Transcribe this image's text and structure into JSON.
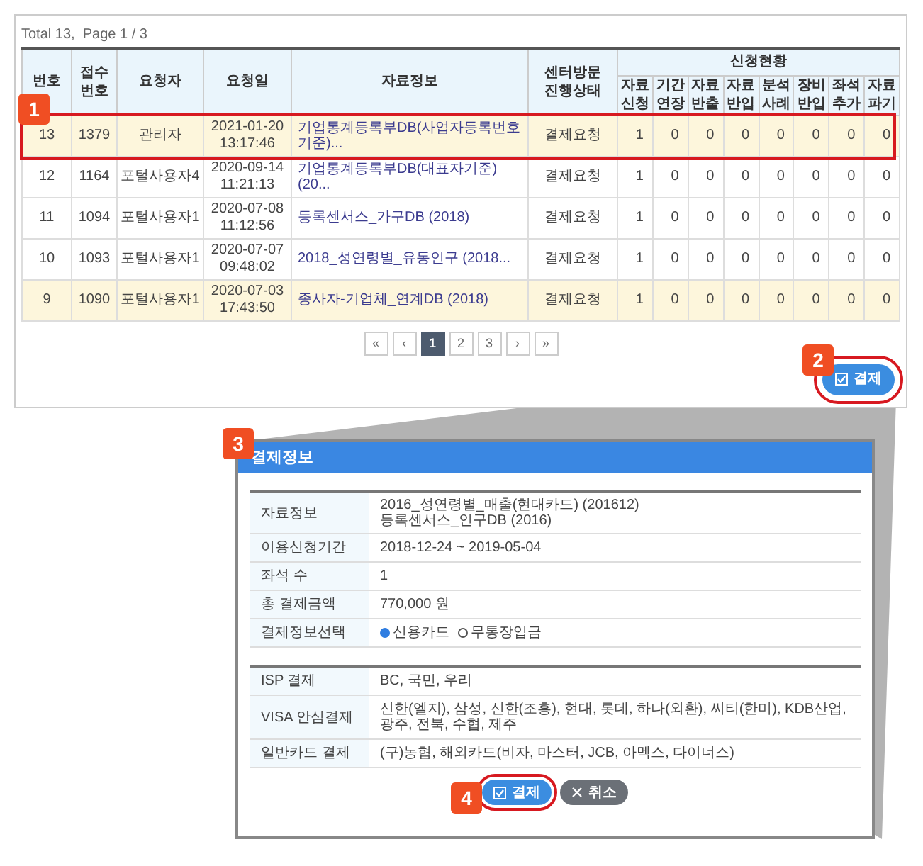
{
  "summary": "Total 13,  Page 1 / 3",
  "table": {
    "columns": [
      "번호",
      "접수\n번호",
      "요청자",
      "요청일",
      "자료정보",
      "센터방문\n진행상태"
    ],
    "group_header": "신청현황",
    "subcolumns": [
      "자료\n신청",
      "기간\n연장",
      "자료\n반출",
      "자료\n반입",
      "분석\n사례",
      "장비\n반입",
      "좌석\n추가",
      "자료\n파기"
    ],
    "rows": [
      {
        "no": "13",
        "receipt": "1379",
        "requester": "관리자",
        "date": "2021-01-20\n13:17:46",
        "data_info": "기업통계등록부DB(사업자등록번호기준)...",
        "status": "결제요청",
        "counts": [
          "1",
          "0",
          "0",
          "0",
          "0",
          "0",
          "0",
          "0"
        ],
        "highlighted": true
      },
      {
        "no": "12",
        "receipt": "1164",
        "requester": "포털사용자4",
        "date": "2020-09-14\n11:21:13",
        "data_info": "기업통계등록부DB(대표자기준) (20...",
        "status": "결제요청",
        "counts": [
          "1",
          "0",
          "0",
          "0",
          "0",
          "0",
          "0",
          "0"
        ],
        "highlighted": false
      },
      {
        "no": "11",
        "receipt": "1094",
        "requester": "포털사용자1",
        "date": "2020-07-08\n11:12:56",
        "data_info": "등록센서스_가구DB (2018)",
        "status": "결제요청",
        "counts": [
          "1",
          "0",
          "0",
          "0",
          "0",
          "0",
          "0",
          "0"
        ],
        "highlighted": false
      },
      {
        "no": "10",
        "receipt": "1093",
        "requester": "포털사용자1",
        "date": "2020-07-07\n09:48:02",
        "data_info": "2018_성연령별_유동인구 (2018...",
        "status": "결제요청",
        "counts": [
          "1",
          "0",
          "0",
          "0",
          "0",
          "0",
          "0",
          "0"
        ],
        "highlighted": false
      },
      {
        "no": "9",
        "receipt": "1090",
        "requester": "포털사용자1",
        "date": "2020-07-03\n17:43:50",
        "data_info": "종사자-기업체_연계DB (2018)",
        "status": "결제요청",
        "counts": [
          "1",
          "0",
          "0",
          "0",
          "0",
          "0",
          "0",
          "0"
        ],
        "highlighted": true
      }
    ]
  },
  "pagination": [
    {
      "label": "«",
      "selected": false
    },
    {
      "label": "‹",
      "selected": false
    },
    {
      "label": "1",
      "selected": true
    },
    {
      "label": "2",
      "selected": false
    },
    {
      "label": "3",
      "selected": false
    },
    {
      "label": "›",
      "selected": false
    },
    {
      "label": "»",
      "selected": false
    }
  ],
  "pay_button": "결제",
  "dialog": {
    "title": "결제정보",
    "info_rows": [
      {
        "kind": "text",
        "label": "자료정보",
        "value": "2016_성연령별_매출(현대카드) (201612)\n등록센서스_인구DB (2016)"
      },
      {
        "kind": "text",
        "label": "이용신청기간",
        "value": "2018-12-24 ~ 2019-05-04"
      },
      {
        "kind": "text",
        "label": "좌석 수",
        "value": "1"
      },
      {
        "kind": "text",
        "label": "총 결제금액",
        "value": "770,000 원"
      },
      {
        "kind": "radio",
        "label": "결제정보선택",
        "options": [
          {
            "label": "신용카드",
            "selected": true
          },
          {
            "label": "무통장입금",
            "selected": false
          }
        ]
      }
    ],
    "card_rows": [
      {
        "label": "ISP 결제",
        "value": "BC, 국민, 우리"
      },
      {
        "label": "VISA 안심결제",
        "value": "신한(엘지), 삼성, 신한(조흥), 현대, 롯데, 하나(외환), 씨티(한미), KDB산업, 광주, 전북, 수협, 제주"
      },
      {
        "label": "일반카드 결제",
        "value": "(구)농협, 해외카드(비자, 마스터, JCB, 아멕스, 다이너스)"
      }
    ],
    "buttons": [
      {
        "label": "결제",
        "kind": "primary"
      },
      {
        "label": "취소",
        "kind": "cancel"
      }
    ]
  },
  "callouts": [
    "1",
    "2",
    "3",
    "4"
  ]
}
